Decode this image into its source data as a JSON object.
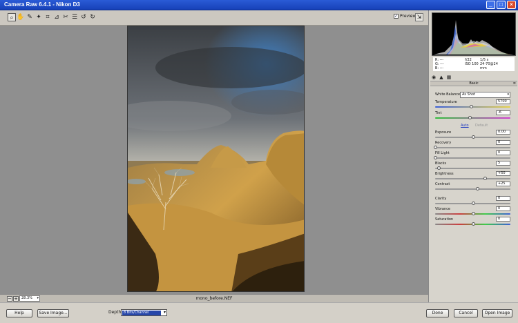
{
  "window": {
    "title": "Camera Raw 6.4.1  -  Nikon D3",
    "minimize_glyph": "_",
    "maximize_glyph": "□",
    "close_glyph": "×"
  },
  "toolbar": {
    "tools": [
      {
        "name": "zoom-icon",
        "glyph": "⌕"
      },
      {
        "name": "hand-icon",
        "glyph": "✋"
      },
      {
        "name": "white-balance-icon",
        "glyph": "✎"
      },
      {
        "name": "color-sampler-icon",
        "glyph": "✦"
      },
      {
        "name": "crop-icon",
        "glyph": "⌗"
      },
      {
        "name": "straighten-icon",
        "glyph": "⊿"
      },
      {
        "name": "spot-removal-icon",
        "glyph": "✂"
      },
      {
        "name": "list-icon",
        "glyph": "☰"
      },
      {
        "name": "rotate-left-icon",
        "glyph": "↺"
      },
      {
        "name": "rotate-right-icon",
        "glyph": "↻"
      }
    ],
    "preview_label": "Preview",
    "preview_checked": true,
    "check_glyph": "✓",
    "fullscreen_glyph": "⇲"
  },
  "status": {
    "zoom_value": "28.3%",
    "zoom_out_glyph": "−",
    "zoom_in_glyph": "+",
    "dropdown_glyph": "▾",
    "filename": "mono_before.NEF"
  },
  "bottom": {
    "help_label": "Help",
    "save_label": "Save Image...",
    "depth_label": "Depth:",
    "depth_value": "8 Bits/Channel",
    "done_label": "Done",
    "cancel_label": "Cancel",
    "open_label": "Open Image"
  },
  "readout": {
    "r": "R:   ---",
    "g": "G:   ---",
    "b": "B:   ---",
    "aperture": "f/22",
    "shutter": "1/5 s",
    "iso": "ISO 100",
    "lens": "24-70@24 mm"
  },
  "tabs": [
    {
      "name": "basic-tab-icon",
      "glyph": "◉"
    },
    {
      "name": "tone-curve-tab-icon",
      "glyph": "▲"
    },
    {
      "name": "detail-tab-icon",
      "glyph": "▦"
    }
  ],
  "panel": {
    "section_title": "Basic",
    "menu_glyph": "≡",
    "white_balance_label": "White Balance:",
    "white_balance_value": "As Shot",
    "auto_label": "Auto",
    "default_label": "Default",
    "sliders": {
      "temperature": {
        "label": "Temperature",
        "value": "5700",
        "fraction": 0.48
      },
      "tint": {
        "label": "Tint",
        "value": "-6",
        "fraction": 0.46
      },
      "exposure": {
        "label": "Exposure",
        "value": "0.00",
        "fraction": 0.5
      },
      "recovery": {
        "label": "Recovery",
        "value": "0",
        "fraction": 0.0
      },
      "fill_light": {
        "label": "Fill Light",
        "value": "0",
        "fraction": 0.0
      },
      "blacks": {
        "label": "Blacks",
        "value": "5",
        "fraction": 0.05
      },
      "brightness": {
        "label": "Brightness",
        "value": "+50",
        "fraction": 0.66
      },
      "contrast": {
        "label": "Contrast",
        "value": "+25",
        "fraction": 0.56
      },
      "clarity": {
        "label": "Clarity",
        "value": "0",
        "fraction": 0.5
      },
      "vibrance": {
        "label": "Vibrance",
        "value": "0",
        "fraction": 0.5
      },
      "saturation": {
        "label": "Saturation",
        "value": "0",
        "fraction": 0.5
      }
    }
  },
  "colors": {
    "titlebar": "#1741b8",
    "canvas": "#8f8f8f",
    "panel": "#d7d4cc",
    "link": "#1c38c0",
    "depth_select": "#2746a9"
  }
}
